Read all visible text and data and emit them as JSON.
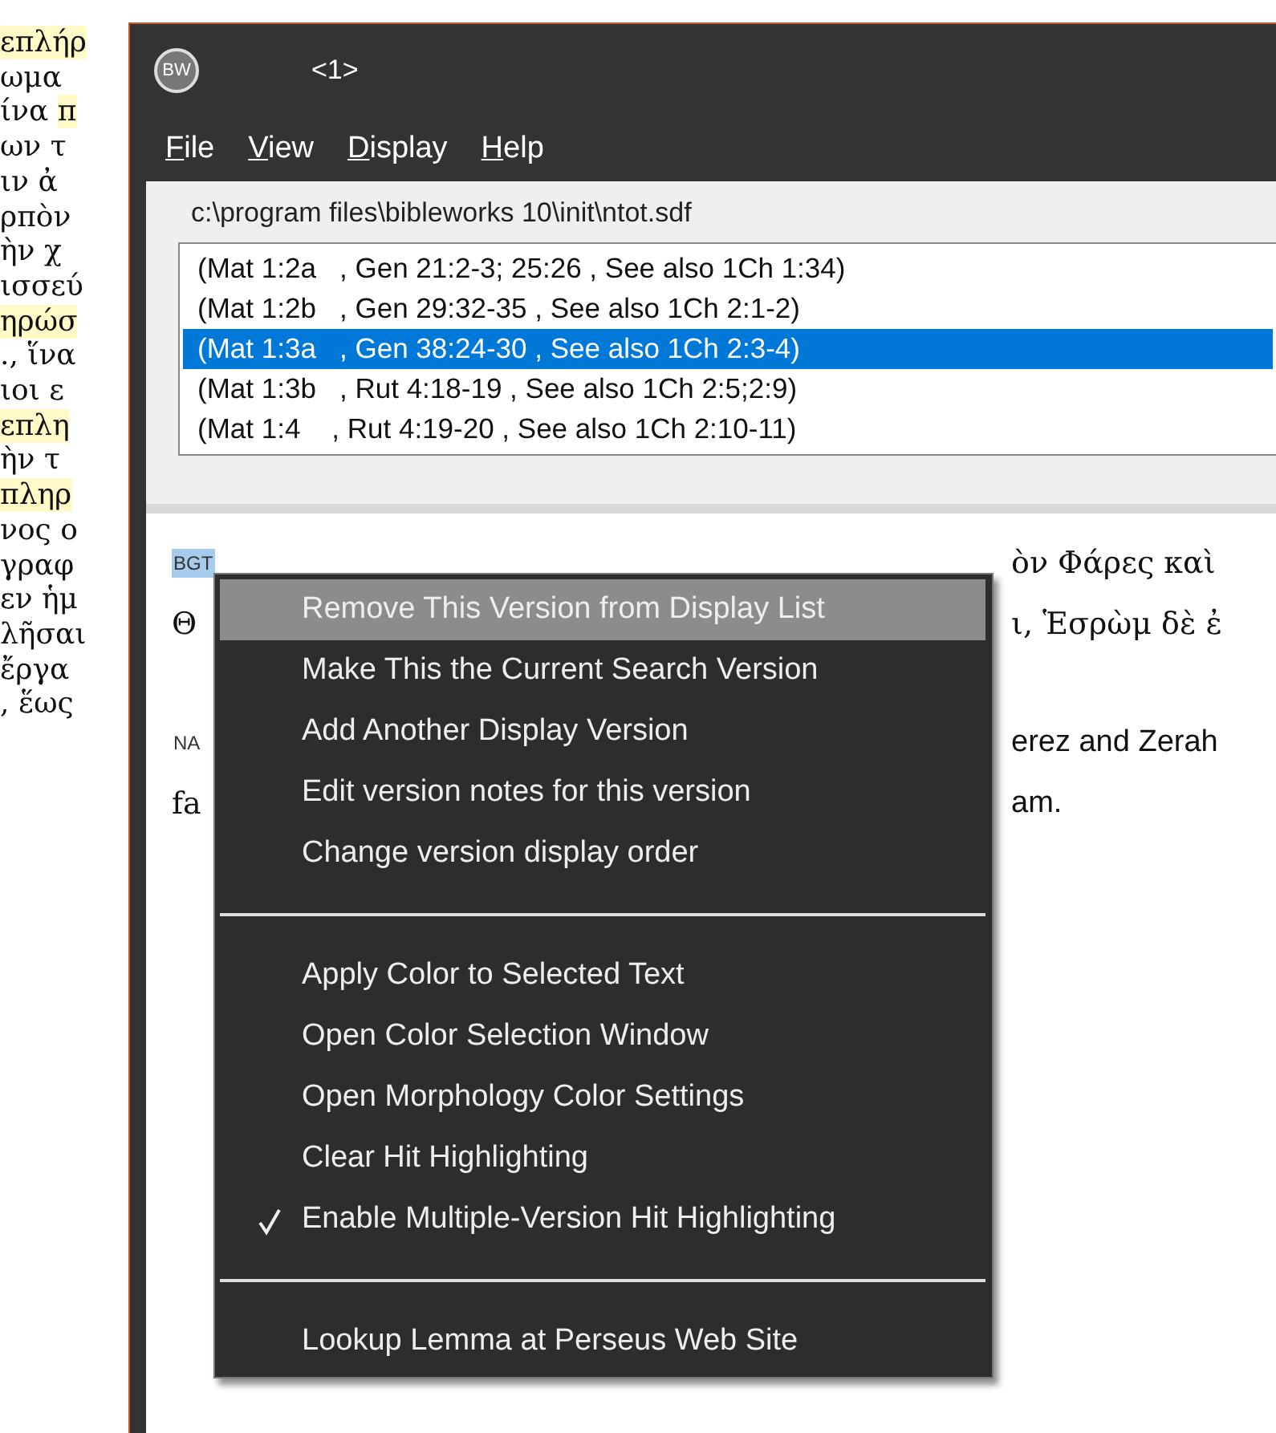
{
  "background_text": [
    {
      "parts": [
        {
          "text": "επλήρ",
          "highlighted": true
        }
      ]
    },
    {
      "parts": [
        {
          "text": "ωμα",
          "highlighted": false
        }
      ]
    },
    {
      "parts": [
        {
          "text": "ίνα ",
          "highlighted": false
        },
        {
          "text": "π",
          "highlighted": true
        }
      ]
    },
    {
      "parts": [
        {
          "text": "ων τ",
          "highlighted": false
        }
      ]
    },
    {
      "parts": [
        {
          "text": "ιν ἀ",
          "highlighted": false
        }
      ]
    },
    {
      "parts": [
        {
          "text": "ρπὸν",
          "highlighted": false
        }
      ]
    },
    {
      "parts": [
        {
          "text": "ὴν χ",
          "highlighted": false
        }
      ]
    },
    {
      "parts": [
        {
          "text": "ισσεύ",
          "highlighted": false
        }
      ]
    },
    {
      "parts": [
        {
          "text": "ηρώσ",
          "highlighted": true
        }
      ]
    },
    {
      "parts": [
        {
          "text": "., ἵνα",
          "highlighted": false
        }
      ]
    },
    {
      "parts": [
        {
          "text": "ιοι ε",
          "highlighted": false
        }
      ]
    },
    {
      "parts": [
        {
          "text": "επλη",
          "highlighted": true
        }
      ]
    },
    {
      "parts": [
        {
          "text": "ὴν τ",
          "highlighted": false
        }
      ]
    },
    {
      "parts": [
        {
          "text": "πληρ",
          "highlighted": true
        }
      ]
    },
    {
      "parts": [
        {
          "text": "νος ο",
          "highlighted": false
        }
      ]
    },
    {
      "parts": [
        {
          "text": "γραφ",
          "highlighted": false
        }
      ]
    },
    {
      "parts": [
        {
          "text": "εν ἡμ",
          "highlighted": false
        }
      ]
    },
    {
      "parts": [
        {
          "text": "λῆσαι",
          "highlighted": false
        }
      ]
    },
    {
      "parts": [
        {
          "text": "ἔργα",
          "highlighted": false
        }
      ]
    },
    {
      "parts": [
        {
          "text": ", ἕως",
          "highlighted": false
        }
      ]
    }
  ],
  "window": {
    "logo": "BW",
    "title": "<1>"
  },
  "menu_bar": [
    {
      "label": "File"
    },
    {
      "label": "View"
    },
    {
      "label": "Display"
    },
    {
      "label": "Help"
    }
  ],
  "file_path": "c:\\program files\\bibleworks 10\\init\\ntot.sdf",
  "cross_references": [
    {
      "text": "(Mat 1:2a   , Gen 21:2-3; 25:26 , See also 1Ch 1:34)",
      "selected": false
    },
    {
      "text": "(Mat 1:2b   , Gen 29:32-35 , See also 1Ch 2:1-2)",
      "selected": false
    },
    {
      "text": "(Mat 1:3a   , Gen 38:24-30 , See also 1Ch 2:3-4)",
      "selected": true
    },
    {
      "text": "(Mat 1:3b   , Rut 4:18-19 , See also 1Ch 2:5;2:9)",
      "selected": false
    },
    {
      "text": "(Mat 1:4    , Rut 4:19-20 , See also 1Ch 2:10-11)",
      "selected": false
    }
  ],
  "verses": [
    {
      "lines": [
        {
          "kind": "version",
          "left": "BGT",
          "right": "ὸν Φάρες καὶ",
          "selected": true
        },
        {
          "kind": "text",
          "left": "Θ",
          "right": "ι, Ἑσρὼμ δὲ ἐ"
        }
      ]
    },
    {
      "lines": [
        {
          "kind": "version",
          "left": "NA",
          "right": "erez and Zerah",
          "selected": false
        },
        {
          "kind": "text",
          "left": "fa",
          "right": "am."
        }
      ]
    }
  ],
  "context_menu": [
    {
      "kind": "item",
      "label": "Remove This Version from Display List",
      "highlighted": true,
      "checked": false
    },
    {
      "kind": "item",
      "label": "Make This the Current Search Version",
      "highlighted": false,
      "checked": false
    },
    {
      "kind": "item",
      "label": "Add Another Display Version",
      "highlighted": false,
      "checked": false
    },
    {
      "kind": "item",
      "label": "Edit version notes for this version",
      "highlighted": false,
      "checked": false
    },
    {
      "kind": "item",
      "label": "Change version display order",
      "highlighted": false,
      "checked": false
    },
    {
      "kind": "separator"
    },
    {
      "kind": "item",
      "label": "Apply Color to Selected Text",
      "highlighted": false,
      "checked": false
    },
    {
      "kind": "item",
      "label": "Open Color Selection Window",
      "highlighted": false,
      "checked": false
    },
    {
      "kind": "item",
      "label": "Open Morphology Color Settings",
      "highlighted": false,
      "checked": false
    },
    {
      "kind": "item",
      "label": "Clear Hit Highlighting",
      "highlighted": false,
      "checked": false
    },
    {
      "kind": "item",
      "label": "Enable Multiple-Version Hit Highlighting",
      "highlighted": false,
      "checked": true
    },
    {
      "kind": "separator"
    },
    {
      "kind": "item",
      "label": "Lookup Lemma at Perseus Web Site",
      "highlighted": false,
      "checked": false
    }
  ]
}
